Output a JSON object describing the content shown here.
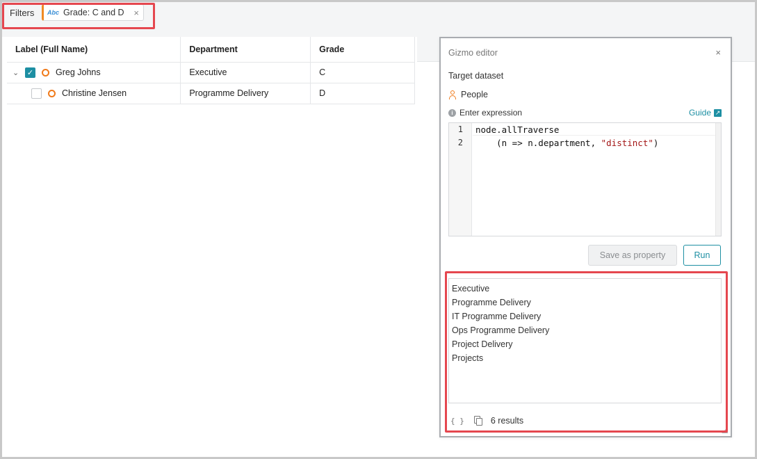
{
  "filter_bar": {
    "label": "Filters",
    "chip": {
      "type_badge": "Abc",
      "text": "Grade: C and D",
      "close": "×"
    }
  },
  "table": {
    "columns": [
      "Label (Full Name)",
      "Department",
      "Grade"
    ],
    "rows": [
      {
        "name": "Greg Johns",
        "department": "Executive",
        "grade": "C",
        "checked": true,
        "expandable": true
      },
      {
        "name": "Christine Jensen",
        "department": "Programme Delivery",
        "grade": "D",
        "checked": false,
        "expandable": false
      }
    ]
  },
  "gizmo": {
    "title": "Gizmo editor",
    "close": "×",
    "target_label": "Target dataset",
    "dataset": "People",
    "expression_label": "Enter expression",
    "guide_label": "Guide",
    "code_lines": [
      {
        "num": "1",
        "text": "node.allTraverse"
      },
      {
        "num": "2",
        "text_prefix": "    (n => n.department, ",
        "string": "\"distinct\"",
        "text_suffix": ")"
      }
    ],
    "save_label": "Save as property",
    "run_label": "Run",
    "results": [
      "Executive",
      "Programme Delivery",
      "IT Programme Delivery",
      "Ops Programme Delivery",
      "Project Delivery",
      "Projects"
    ],
    "results_count": "6 results",
    "braces": "{ }"
  },
  "colors": {
    "accent": "#1d8fa3",
    "highlight": "#e5474f",
    "node": "#f07a1a"
  }
}
